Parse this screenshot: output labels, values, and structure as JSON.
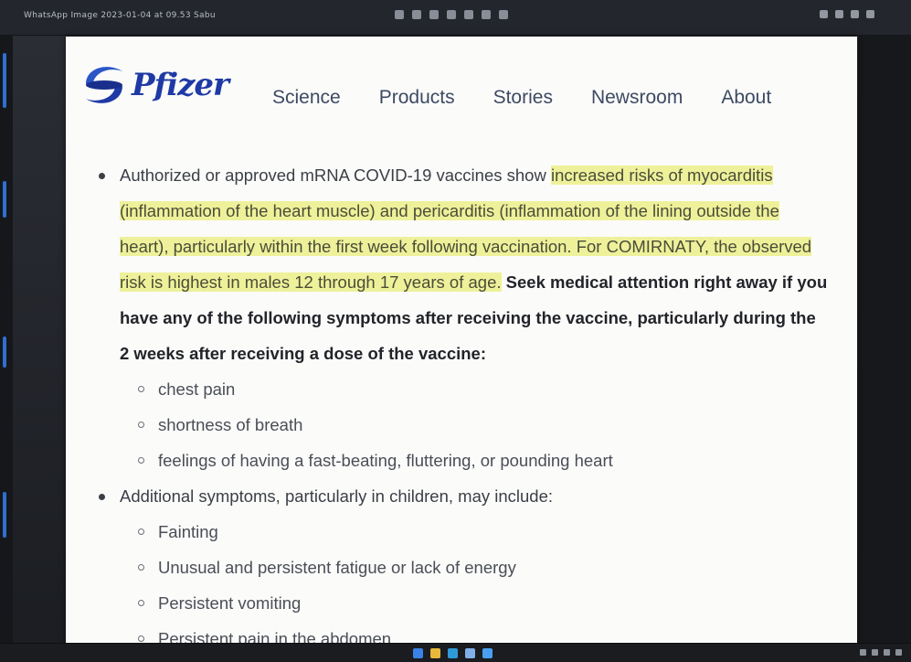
{
  "window": {
    "title": "WhatsApp Image 2023-01-04 at 09.53 Sabu"
  },
  "site": {
    "brand": "Pfizer",
    "brand_color": "#1f3aa5",
    "nav": [
      "Science",
      "Products",
      "Stories",
      "Newsroom",
      "About"
    ]
  },
  "content": {
    "bullet1": {
      "plain_start": "Authorized or approved mRNA COVID-19 vaccines show ",
      "highlighted": "increased risks of myocarditis (inflammation of the heart muscle) and pericarditis (inflammation of the lining outside the heart), particularly within the first week following vaccination. For COMIRNATY, the observed risk is highest in males 12 through 17 years of age.",
      "bold": "Seek medical attention right away if you have any of the following symptoms after receiving the vaccine, particularly during the 2 weeks after receiving a dose of the vaccine:",
      "symptoms": [
        "chest pain",
        "shortness of breath",
        "feelings of having a fast-beating, fluttering, or pounding heart"
      ]
    },
    "bullet2": {
      "text": "Additional symptoms, particularly in children, may include:",
      "symptoms": [
        "Fainting",
        "Unusual and persistent fatigue or lack of energy",
        "Persistent vomiting",
        "Persistent pain in the abdomen"
      ]
    }
  },
  "colors": {
    "highlight": "#eef19a",
    "page_bg": "#fbfbfa",
    "frame_bg": "#1d1f24"
  }
}
